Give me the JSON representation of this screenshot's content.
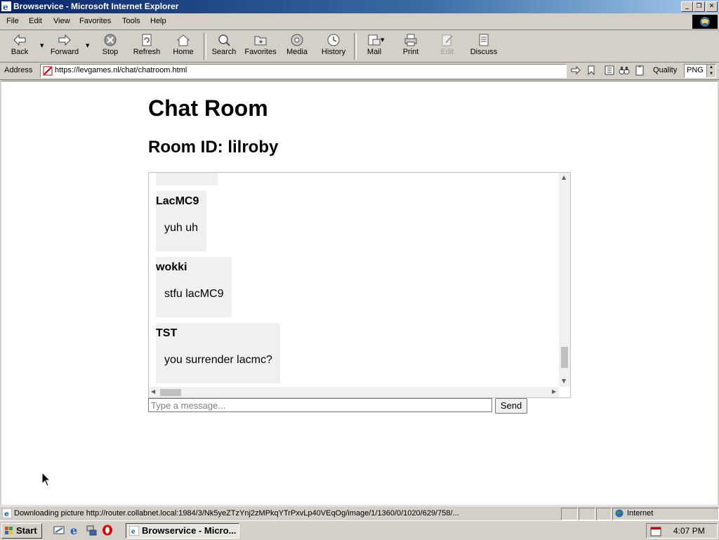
{
  "window": {
    "title": "Browservice - Microsoft Internet Explorer",
    "controls": [
      "minimize",
      "maximize",
      "close"
    ]
  },
  "menubar": {
    "items": [
      "File",
      "Edit",
      "View",
      "Favorites",
      "Tools",
      "Help"
    ]
  },
  "toolbar": {
    "back": "Back",
    "forward": "Forward",
    "stop": "Stop",
    "refresh": "Refresh",
    "home": "Home",
    "search": "Search",
    "favorites": "Favorites",
    "media": "Media",
    "history": "History",
    "mail": "Mail",
    "print": "Print",
    "edit": "Edit",
    "discuss": "Discuss"
  },
  "addressbar": {
    "label": "Address",
    "url": "https://levgames.nl/chat/chatroom.html",
    "quality_label": "Quality",
    "quality_value": "PNG"
  },
  "page": {
    "title": "Chat Room",
    "room_id_line": "Room ID: lilroby",
    "messages": [
      {
        "user": "LacMC9",
        "text": "yuh uh"
      },
      {
        "user": "wokki",
        "text": "stfu lacMC9"
      },
      {
        "user": "TST",
        "text": "you surrender lacmc?"
      }
    ],
    "input_placeholder": "Type a message...",
    "send_label": "Send"
  },
  "statusbar": {
    "text": "Downloading picture http://router.collabnet.local:1984/3/Nk5yeZTzYnj2zMPkqYTrPxvLp40VEqOg/image/1/1360/0/1020/629/758/...",
    "zone": "Internet"
  },
  "taskbar": {
    "start": "Start",
    "task_item": "Browservice - Micro...",
    "clock": "4:07 PM"
  },
  "colors": {
    "titlebar": "#0a246a",
    "chrome": "#d4d0c8",
    "message_bg": "#f0f0f0"
  }
}
